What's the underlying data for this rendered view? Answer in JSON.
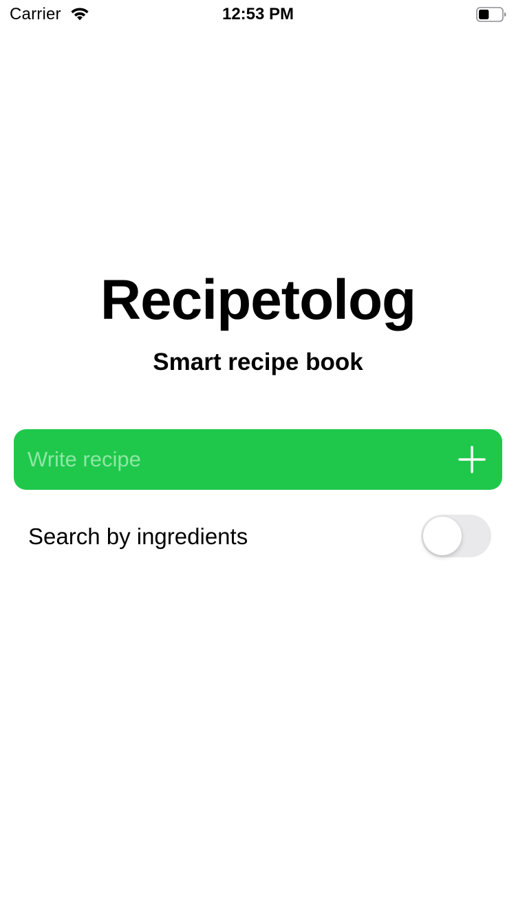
{
  "status_bar": {
    "carrier": "Carrier",
    "time": "12:53 PM",
    "wifi_icon": "wifi-icon",
    "battery_icon": "battery-icon",
    "battery_level": 0.45
  },
  "main": {
    "title": "Recipetolog",
    "subtitle": "Smart recipe book",
    "recipe_input": {
      "value": "",
      "placeholder": "Write recipe",
      "icon": "plus-icon"
    },
    "search_toggle": {
      "label": "Search by ingredients",
      "on": false
    }
  },
  "colors": {
    "accent_green": "#1fc84b",
    "placeholder_text": "#8fe6a6",
    "toggle_off_track": "#e9e9eb"
  }
}
